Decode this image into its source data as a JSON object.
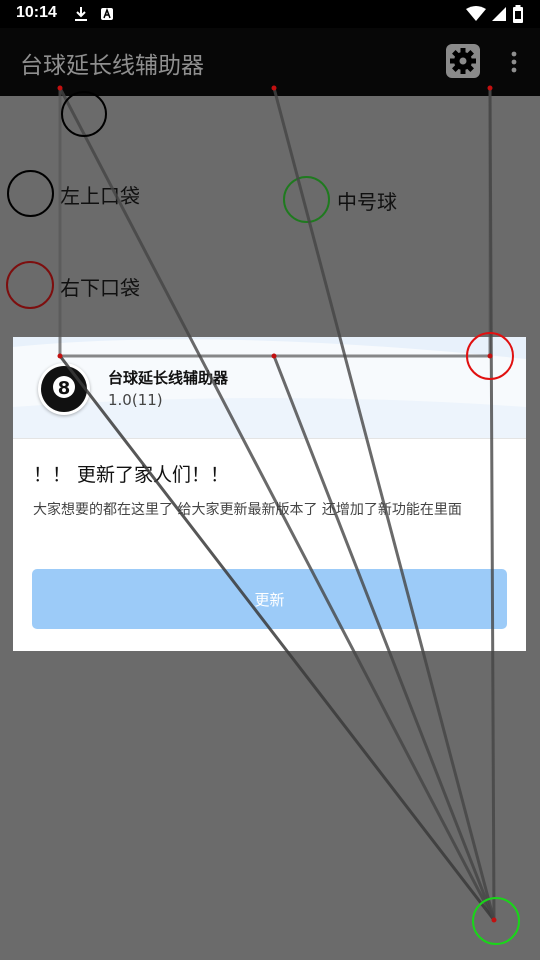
{
  "status_bar": {
    "time": "10:14",
    "left_icons": [
      "download-icon",
      "a-notification-icon"
    ],
    "right_icons": [
      "wifi-icon",
      "signal-icon",
      "battery-icon"
    ]
  },
  "app_bar": {
    "title": "台球延长线辅助器",
    "settings_icon": "gear-icon",
    "more_icon": "more-vert-icon"
  },
  "legend": {
    "top_left_pocket": "左上口袋",
    "middle_ball": "中号球",
    "bottom_right_pocket": "右下口袋"
  },
  "dialog": {
    "app_icon": "eight-ball-icon",
    "app_icon_text": "8",
    "app_name": "台球延长线辅助器",
    "version": "1.0(11)",
    "title": "！！ 更新了家人们！！",
    "description": "大家想要的都在这里了 给大家更新最新版本了 还增加了新功能在里面",
    "update_button": "更新"
  },
  "colors": {
    "status_bar": "#000000",
    "app_bar": "#070707",
    "canvas_background": "#6b6b6b",
    "top_left_pocket_marker": "#000000",
    "middle_ball_marker": "#1f7a1f",
    "bottom_right_pocket_marker": "#7d0e0e",
    "dialog_background": "#ffffff",
    "update_button": "#9ccbf8",
    "aim_marker_red": "#e01010",
    "aim_marker_green": "#19d619"
  }
}
